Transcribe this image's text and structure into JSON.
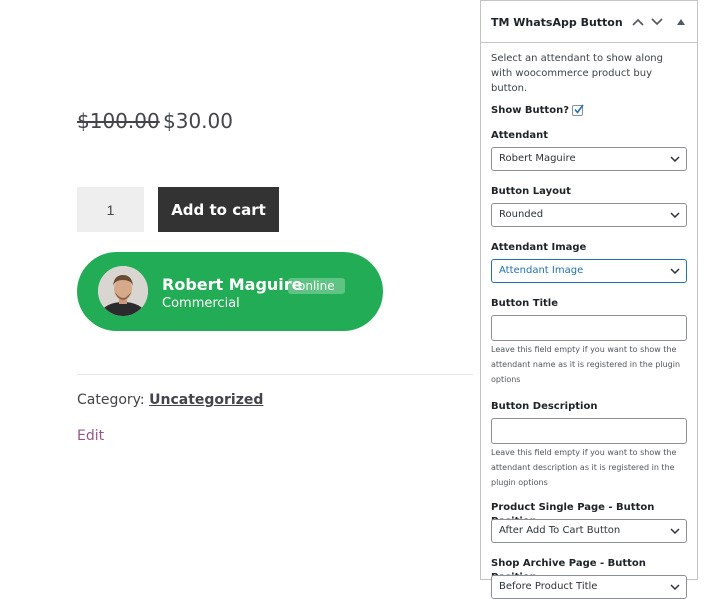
{
  "product": {
    "price_old": "$100.00",
    "price_new": "$30.00",
    "quantity": "1",
    "add_to_cart_label": "Add to cart",
    "category_label": "Category:",
    "category_value": "Uncategorized",
    "edit_label": "Edit"
  },
  "whatsapp_button": {
    "name": "Robert Maguire",
    "status": "online",
    "description": "Commercial",
    "color": "#22ac55"
  },
  "panel": {
    "title": "TM WhatsApp Button",
    "intro": "Select an attendant to show along with woocommerce product buy button.",
    "show_button_label": "Show Button?",
    "show_button_checked": true,
    "attendant": {
      "label": "Attendant",
      "value": "Robert Maguire"
    },
    "layout": {
      "label": "Button Layout",
      "value": "Rounded"
    },
    "image": {
      "label": "Attendant Image",
      "value": "Attendant Image"
    },
    "title_field": {
      "label": "Button Title",
      "value": "",
      "help": "Leave this field empty if you want to show the attendant name as it is registered in the plugin options"
    },
    "description_field": {
      "label": "Button Description",
      "value": "",
      "help": "Leave this field empty if you want to show the attendant description as it is registered in the plugin options"
    },
    "single_position": {
      "label": "Product Single Page - Button Position",
      "value": "After Add To Cart Button"
    },
    "archive_position": {
      "label": "Shop Archive Page - Button Position",
      "value": "Before Product Title"
    }
  }
}
